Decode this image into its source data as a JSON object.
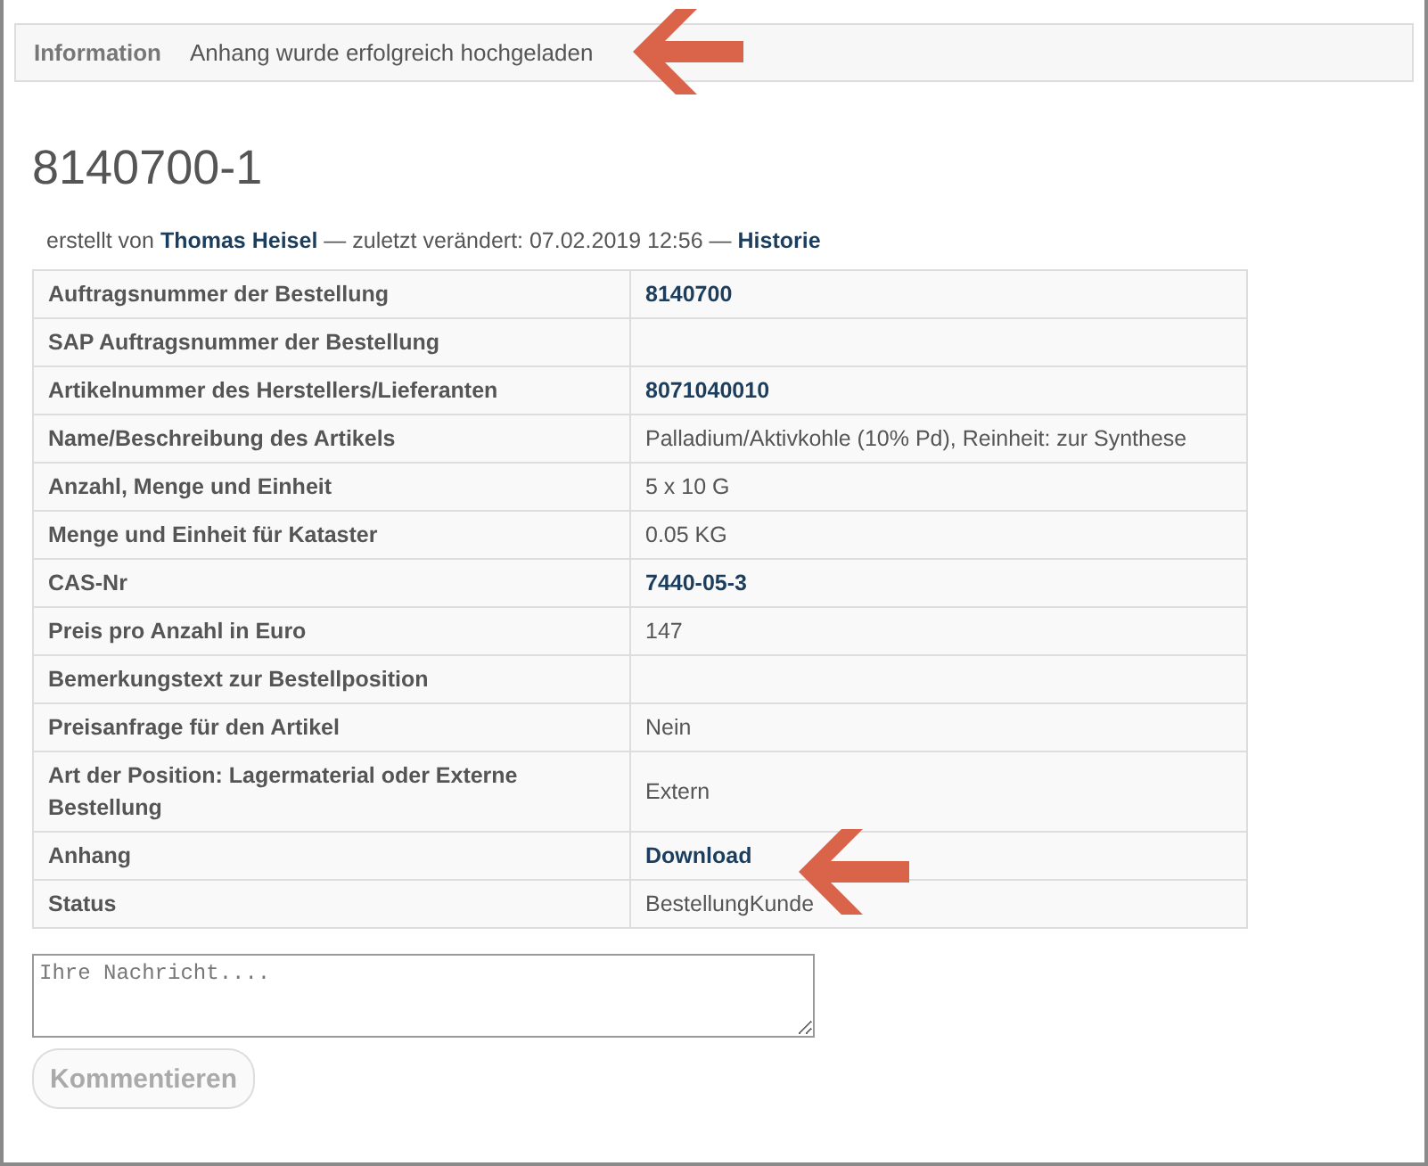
{
  "notice": {
    "label": "Information",
    "message": "Anhang wurde erfolgreich hochgeladen"
  },
  "title": "8140700-1",
  "meta": {
    "created_prefix": "erstellt von",
    "author": "Thomas Heisel",
    "changed": "— zuletzt verändert: 07.02.2019 12:56 —",
    "history_link": "Historie"
  },
  "details": [
    {
      "label": "Auftragsnummer der Bestellung",
      "value": "8140700",
      "kind": "link"
    },
    {
      "label": "SAP Auftragsnummer der Bestellung"
    },
    {
      "label": "Artikelnummer des Herstellers/Lieferanten",
      "value": "8071040010",
      "kind": "link"
    },
    {
      "label": "Name/Beschreibung des Artikels",
      "value": "Palladium/Aktivkohle (10% Pd), Reinheit: zur Synthese",
      "kind": "text"
    },
    {
      "label": "Anzahl, Menge und Einheit",
      "value": "5 x 10 G",
      "kind": "text"
    },
    {
      "label": "Menge und Einheit für Kataster",
      "value": "0.05 KG",
      "kind": "text"
    },
    {
      "label": "CAS-Nr",
      "value": "7440-05-3",
      "kind": "link"
    },
    {
      "label": "Preis pro Anzahl in Euro",
      "value": "147",
      "kind": "text"
    },
    {
      "label": "Bemerkungstext zur Bestellposition"
    },
    {
      "label": "Preisanfrage für den Artikel",
      "value": "Nein",
      "kind": "text"
    },
    {
      "label": "Art der Position: Lagermaterial oder Externe Bestellung",
      "value": "Extern",
      "kind": "text"
    },
    {
      "label": "Anhang",
      "value": "Download",
      "kind": "link"
    },
    {
      "label": "Status",
      "value": "BestellungKunde",
      "kind": "text"
    }
  ],
  "comment": {
    "placeholder": "Ihre Nachricht....",
    "button": "Kommentieren",
    "disabled": true
  }
}
